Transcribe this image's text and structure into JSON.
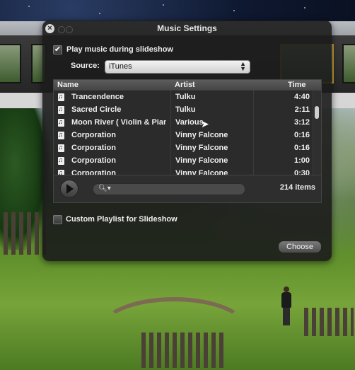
{
  "window": {
    "title": "Music Settings"
  },
  "options": {
    "play_music_label": "Play music during slideshow",
    "play_music_checked": true,
    "custom_playlist_label": "Custom Playlist for Slideshow",
    "custom_playlist_checked": false
  },
  "source": {
    "label": "Source:",
    "selected": "iTunes"
  },
  "table": {
    "columns": [
      "Name",
      "Artist",
      "Time"
    ],
    "rows": [
      {
        "name": "Trancendence",
        "artist": "Tulku",
        "time": "4:40"
      },
      {
        "name": "Sacred Circle",
        "artist": "Tulku",
        "time": "2:11"
      },
      {
        "name": "Moon River ( Violin & Piano )",
        "artist": "Various",
        "time": "3:12"
      },
      {
        "name": "Corporation",
        "artist": "Vinny Falcone",
        "time": "0:16"
      },
      {
        "name": "Corporation",
        "artist": "Vinny Falcone",
        "time": "0:16"
      },
      {
        "name": "Corporation",
        "artist": "Vinny Falcone",
        "time": "1:00"
      },
      {
        "name": "Corporation",
        "artist": "Vinny Falcone",
        "time": "0:30"
      }
    ]
  },
  "controls": {
    "search_value": "",
    "item_count": "214 items"
  },
  "buttons": {
    "choose_label": "Choose"
  },
  "colors": {
    "panel": "#1c1c1c",
    "thumb_selected_border": "#c99a2e"
  },
  "icons": {
    "close": "close-icon",
    "play": "play-icon",
    "search": "search-icon",
    "checkmark": "checkmark-icon"
  }
}
